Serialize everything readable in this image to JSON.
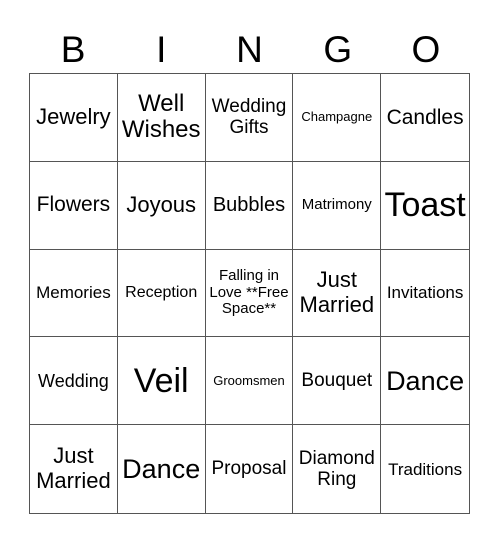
{
  "header": [
    "B",
    "I",
    "N",
    "G",
    "O"
  ],
  "cells": [
    {
      "text": "Jewelry",
      "size": 22
    },
    {
      "text": "Well Wishes",
      "size": 24
    },
    {
      "text": "Wedding Gifts",
      "size": 19
    },
    {
      "text": "Champagne",
      "size": 13
    },
    {
      "text": "Candles",
      "size": 21
    },
    {
      "text": "Flowers",
      "size": 21
    },
    {
      "text": "Joyous",
      "size": 22
    },
    {
      "text": "Bubbles",
      "size": 20
    },
    {
      "text": "Matrimony",
      "size": 15
    },
    {
      "text": "Toast",
      "size": 34
    },
    {
      "text": "Memories",
      "size": 17
    },
    {
      "text": "Reception",
      "size": 16
    },
    {
      "text": "Falling in Love **Free Space**",
      "size": 15
    },
    {
      "text": "Just Married",
      "size": 22
    },
    {
      "text": "Invitations",
      "size": 17
    },
    {
      "text": "Wedding",
      "size": 18
    },
    {
      "text": "Veil",
      "size": 34
    },
    {
      "text": "Groomsmen",
      "size": 13
    },
    {
      "text": "Bouquet",
      "size": 19
    },
    {
      "text": "Dance",
      "size": 27
    },
    {
      "text": "Just Married",
      "size": 22
    },
    {
      "text": "Dance",
      "size": 27
    },
    {
      "text": "Proposal",
      "size": 19
    },
    {
      "text": "Diamond Ring",
      "size": 19
    },
    {
      "text": "Traditions",
      "size": 17
    }
  ]
}
